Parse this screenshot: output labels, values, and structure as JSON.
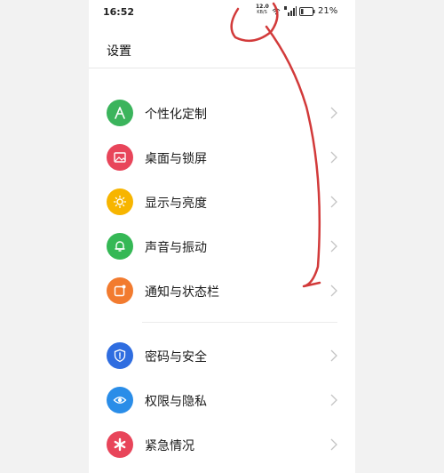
{
  "status_bar": {
    "time": "16:52",
    "net_speed_value": "12.0",
    "net_speed_unit": "KB/S",
    "battery_percent": "21%",
    "battery_level": 0.21
  },
  "header": {
    "title": "设置"
  },
  "groups": [
    {
      "items": [
        {
          "label": "个性化定制",
          "icon": "personalize-icon",
          "color": "#3bb45c"
        },
        {
          "label": "桌面与锁屏",
          "icon": "wallpaper-icon",
          "color": "#e8455a"
        },
        {
          "label": "显示与亮度",
          "icon": "brightness-icon",
          "color": "#f7b500"
        },
        {
          "label": "声音与振动",
          "icon": "bell-icon",
          "color": "#35b855"
        },
        {
          "label": "通知与状态栏",
          "icon": "notification-icon",
          "color": "#f27b2f"
        }
      ]
    },
    {
      "items": [
        {
          "label": "密码与安全",
          "icon": "shield-icon",
          "color": "#2f6de0"
        },
        {
          "label": "权限与隐私",
          "icon": "privacy-eye-icon",
          "color": "#2a8de8"
        },
        {
          "label": "紧急情况",
          "icon": "emergency-icon",
          "color": "#e8455a"
        }
      ]
    }
  ],
  "annotation_color": "#d23a3a"
}
